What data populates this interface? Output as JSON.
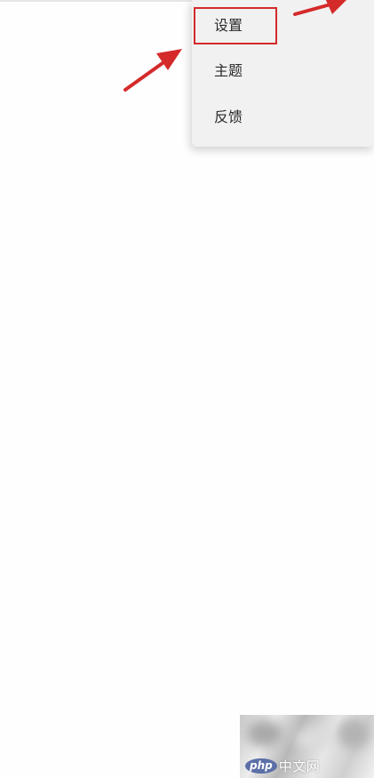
{
  "menu": {
    "items": [
      {
        "label": "设置",
        "highlighted": true
      },
      {
        "label": "主题"
      },
      {
        "label": "反馈"
      }
    ]
  },
  "annotations": {
    "highlight_color": "#d42a2a",
    "arrow_color": "#d42a2a"
  },
  "watermark": {
    "logo_text": "php",
    "site_text": "中文网"
  }
}
